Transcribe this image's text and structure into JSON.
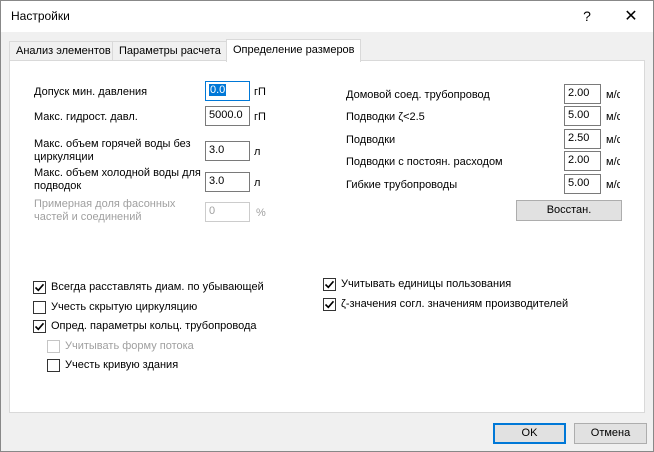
{
  "window": {
    "title": "Настройки",
    "help_glyph": "?",
    "close_glyph": "✕"
  },
  "tabs": [
    {
      "label": "Анализ элементов",
      "active": false
    },
    {
      "label": "Параметры расчета",
      "active": false
    },
    {
      "label": "Определение размеров",
      "active": true
    }
  ],
  "left_fields": [
    {
      "label": "Допуск мин. давления",
      "value": "0.0",
      "unit": "гП"
    },
    {
      "label": "Макс. гидрост. давл.",
      "value": "5000.0",
      "unit": "гП"
    },
    {
      "label_line1": "Макс. объем горячей воды без",
      "label_line2": "циркуляции",
      "value": "3.0",
      "unit": "л"
    },
    {
      "label_line1": "Макс. объем холодной воды для",
      "label_line2": "подводок",
      "value": "3.0",
      "unit": "л"
    },
    {
      "label_line1": "Примерная доля фасонных",
      "label_line2": "частей и соединений",
      "value": "0",
      "unit": "%"
    }
  ],
  "right_fields": [
    {
      "label": "Домовой соед. трубопровод",
      "value": "2.00",
      "unit": "м/с"
    },
    {
      "label": "Подводки ζ<2.5",
      "value": "5.00",
      "unit": "м/с"
    },
    {
      "label": "Подводки",
      "value": "2.50",
      "unit": "м/с"
    },
    {
      "label": "Подводки с постоян. расходом",
      "value": "2.00",
      "unit": "м/с"
    },
    {
      "label": "Гибкие трубопроводы",
      "value": "5.00",
      "unit": "м/с"
    }
  ],
  "restore_button": "Восстан.",
  "checkboxes_left": [
    {
      "label": "Всегда расставлять диам. по убывающей",
      "checked": true,
      "disabled": false
    },
    {
      "label": "Учесть скрытую циркуляцию",
      "checked": false,
      "disabled": false
    },
    {
      "label": "Опред. параметры кольц. трубопровода",
      "checked": true,
      "disabled": false
    },
    {
      "label": "Учитывать форму потока",
      "checked": false,
      "disabled": true
    },
    {
      "label": "Учесть кривую здания",
      "checked": false,
      "disabled": false
    }
  ],
  "checkboxes_right": [
    {
      "label": "Учитывать единицы пользования",
      "checked": true,
      "disabled": false
    },
    {
      "label": "ζ-значения согл. значениям производителей",
      "checked": true,
      "disabled": false
    }
  ],
  "footer": {
    "ok_label": "OK",
    "cancel_label": "Отмена"
  },
  "colors": {
    "accent": "#0078d7",
    "disabled_text": "#a0a0a0"
  }
}
